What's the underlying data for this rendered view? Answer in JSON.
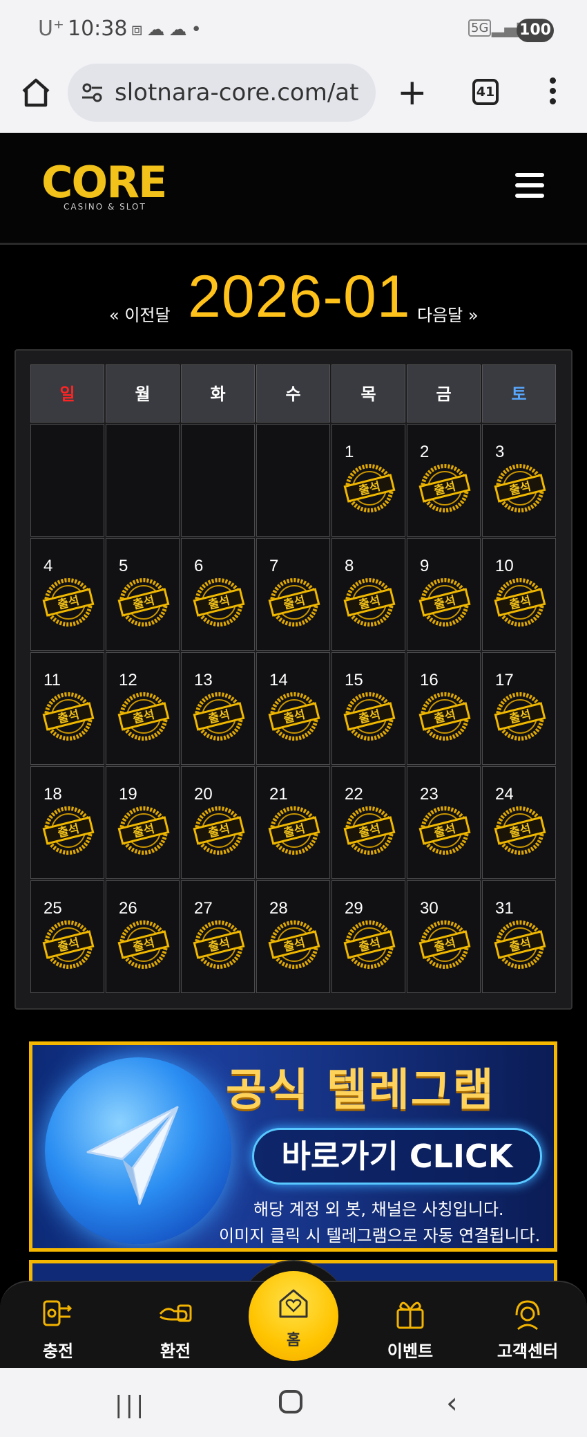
{
  "status_bar": {
    "carrier": "U⁺",
    "time": "10:38",
    "network": "5G",
    "battery": "100"
  },
  "browser": {
    "url": "slotnara-core.com/at",
    "tab_count": "41"
  },
  "site": {
    "logo_text": "CORE",
    "logo_subtitle": "CASINO & SLOT"
  },
  "calendar": {
    "prev_label": "« 이전달",
    "next_label": "다음달 »",
    "month_title": "2026-01",
    "weekdays": [
      "일",
      "월",
      "화",
      "수",
      "목",
      "금",
      "토"
    ],
    "stamp_text": "출석",
    "weeks": [
      [
        null,
        null,
        null,
        null,
        "1",
        "2",
        "3"
      ],
      [
        "4",
        "5",
        "6",
        "7",
        "8",
        "9",
        "10"
      ],
      [
        "11",
        "12",
        "13",
        "14",
        "15",
        "16",
        "17"
      ],
      [
        "18",
        "19",
        "20",
        "21",
        "22",
        "23",
        "24"
      ],
      [
        "25",
        "26",
        "27",
        "28",
        "29",
        "30",
        "31"
      ]
    ]
  },
  "banner": {
    "title": "공식 텔레그램",
    "cta": "바로가기 CLICK",
    "line1": "해당 계정 외 봇, 채널은 사칭입니다.",
    "line2": "이미지 클릭 시 텔레그램으로 자동 연결됩니다."
  },
  "bottom_nav": {
    "deposit": "충전",
    "withdraw": "환전",
    "home": "홈",
    "event": "이벤트",
    "support": "고객센터"
  },
  "colors": {
    "gold": "#ffc21a",
    "sunday": "#ff2424",
    "saturday": "#58a8ff"
  }
}
